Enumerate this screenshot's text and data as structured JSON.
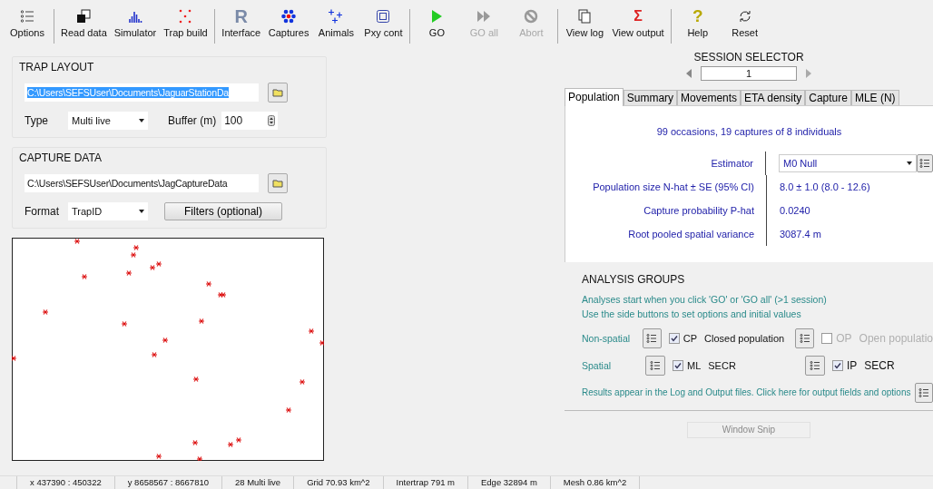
{
  "toolbar_groups": [
    {
      "items": [
        {
          "label": "Options",
          "disabled": false
        }
      ]
    },
    {
      "items": [
        {
          "label": "Read data",
          "disabled": false
        },
        {
          "label": "Simulator",
          "disabled": false
        },
        {
          "label": "Trap build",
          "disabled": false
        }
      ]
    },
    {
      "items": [
        {
          "label": "Interface",
          "disabled": false,
          "glyph": "R"
        },
        {
          "label": "Captures",
          "disabled": false
        },
        {
          "label": "Animals",
          "disabled": false
        },
        {
          "label": "Pxy cont",
          "disabled": false
        }
      ]
    },
    {
      "items": [
        {
          "label": "GO",
          "disabled": false
        },
        {
          "label": "GO all",
          "disabled": true
        },
        {
          "label": "Abort",
          "disabled": true
        }
      ]
    },
    {
      "items": [
        {
          "label": "View log",
          "disabled": false
        },
        {
          "label": "View output",
          "disabled": false,
          "glyph": "Σ"
        }
      ]
    },
    {
      "items": [
        {
          "label": "Help",
          "disabled": false,
          "glyph": "?"
        },
        {
          "label": "Reset",
          "disabled": false
        }
      ]
    }
  ],
  "trap_layout": {
    "title": "TRAP LAYOUT",
    "file": "C:\\Users\\SEFSUser\\Documents\\JaguarStationDa",
    "file_selected": true,
    "type_label": "Type",
    "type_value": "Multi live",
    "buffer_label": "Buffer (m)",
    "buffer_value": "100"
  },
  "capture_data": {
    "title": "CAPTURE DATA",
    "file": "C:\\Users\\SEFSUser\\Documents\\JagCaptureData",
    "format_label": "Format",
    "format_value": "TrapID",
    "filters_button": "Filters (optional)"
  },
  "session_selector": {
    "title": "SESSION SELECTOR",
    "value": "1"
  },
  "tabs": [
    {
      "label": "Population",
      "selected": true
    },
    {
      "label": "Summary",
      "selected": false
    },
    {
      "label": "Movements",
      "selected": false
    },
    {
      "label": "ETA density",
      "selected": false
    },
    {
      "label": "Capture",
      "selected": false
    },
    {
      "label": "MLE (N)",
      "selected": false
    }
  ],
  "population": {
    "summary": "99 occasions, 19 captures of 8 individuals",
    "rows": [
      {
        "label": "Estimator",
        "value": "M0 Null",
        "kind": "dropdown"
      },
      {
        "label": "Population size  N-hat ± SE (95% CI)",
        "value": "8.0 ± 1.0 (8.0 - 12.6)",
        "kind": "text"
      },
      {
        "label": "Capture probability  P-hat",
        "value": "0.0240",
        "kind": "text"
      },
      {
        "label": "Root pooled spatial variance",
        "value": "3087.4 m",
        "kind": "text"
      }
    ]
  },
  "analysis_groups": {
    "title": "ANALYSIS GROUPS",
    "notes": [
      "Analyses start when you click 'GO' or 'GO all' (>1 session)",
      "Use the side buttons to set options and initial values"
    ],
    "rows": [
      {
        "label": "Non-spatial",
        "options": [
          {
            "code": "CP",
            "name": "Closed population",
            "checked": true,
            "disabled": false
          },
          {
            "code": "OP",
            "name": "Open populatio",
            "checked": false,
            "disabled": true
          }
        ]
      },
      {
        "label": "Spatial",
        "options": [
          {
            "code": "ML",
            "name": "SECR",
            "checked": true,
            "disabled": false
          },
          {
            "code": "IP",
            "name": "SECR",
            "checked": true,
            "disabled": false
          }
        ]
      }
    ],
    "footer": "Results appear in the Log and Output files. Click here for output fields and options"
  },
  "window_snip": "Window Snip",
  "status_bar": [
    "x 437390 : 450322",
    "y 8658567 : 8667810",
    "28 Multi live",
    "Grid 70.93 km^2",
    "Intertrap 791 m",
    "Edge 32894 m",
    "Mesh 0.86 km^2"
  ]
}
